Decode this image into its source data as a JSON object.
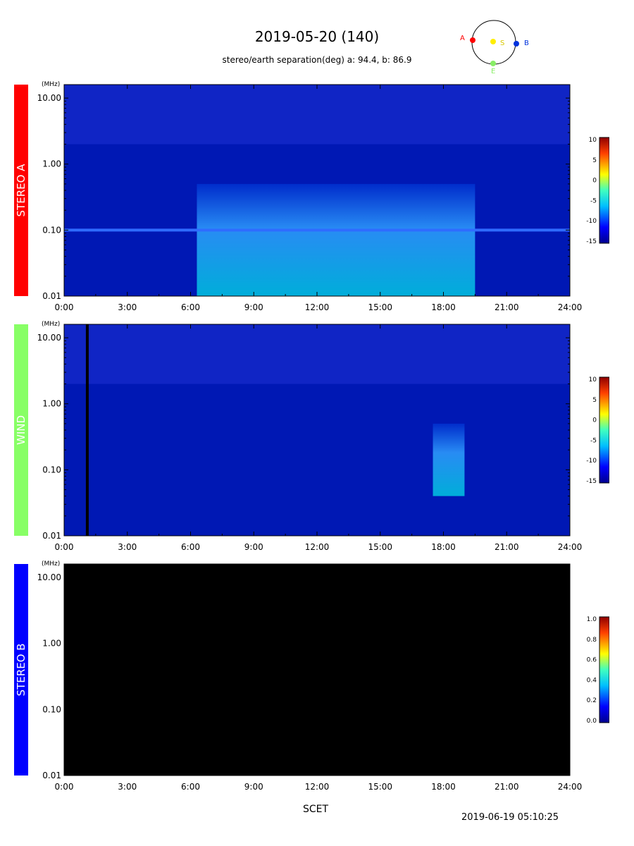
{
  "header": {
    "title": "2019-05-20 (140)",
    "separation": "stereo/earth separation(deg) a:  94.4, b:  86.9",
    "orbit_labels": {
      "a": "A",
      "s": "S",
      "b": "B",
      "e": "E"
    }
  },
  "footer": {
    "xlabel": "SCET",
    "timestamp": "2019-06-19 05:10:25"
  },
  "chart_data": [
    {
      "type": "heatmap",
      "panel": "STEREO A",
      "panel_color": "#ff0000",
      "y_unit": "(MHz)",
      "y_scale": "log",
      "ylim": [
        0.01,
        16
      ],
      "y_ticks": [
        "10.00",
        "1.00",
        "0.10",
        "0.01"
      ],
      "x_ticks": [
        "0:00",
        "3:00",
        "6:00",
        "9:00",
        "12:00",
        "15:00",
        "18:00",
        "21:00",
        "24:00"
      ],
      "xlim_hours": [
        0,
        24
      ],
      "colorbar": {
        "ticks": [
          "10",
          "5",
          "0",
          "-5",
          "-10",
          "-15"
        ],
        "range": [
          -15,
          10
        ]
      },
      "features": [
        {
          "kind": "enhanced emission band",
          "start_h": 6.3,
          "end_h": 19.5,
          "f_low_mhz": 0.01,
          "f_high_mhz": 0.5
        },
        {
          "kind": "line",
          "freq_mhz": 0.1,
          "start_h": 0,
          "end_h": 24
        }
      ]
    },
    {
      "type": "heatmap",
      "panel": "WIND",
      "panel_color": "#88ff66",
      "y_unit": "(MHz)",
      "y_scale": "log",
      "ylim": [
        0.01,
        16
      ],
      "y_ticks": [
        "10.00",
        "1.00",
        "0.10",
        "0.01"
      ],
      "x_ticks": [
        "0:00",
        "3:00",
        "6:00",
        "9:00",
        "12:00",
        "15:00",
        "18:00",
        "21:00",
        "24:00"
      ],
      "xlim_hours": [
        0,
        24
      ],
      "colorbar": {
        "ticks": [
          "10",
          "5",
          "0",
          "-5",
          "-10",
          "-15"
        ],
        "range": [
          -15,
          10
        ]
      },
      "features": [
        {
          "kind": "type III burst",
          "start_h": 17.5,
          "end_h": 19.0,
          "f_low_mhz": 0.04,
          "f_high_mhz": 0.5
        },
        {
          "kind": "data gap",
          "time_h": 1.1
        }
      ]
    },
    {
      "type": "heatmap",
      "panel": "STEREO B",
      "panel_color": "#0000ff",
      "y_unit": "(MHz)",
      "y_scale": "log",
      "ylim": [
        0.01,
        16
      ],
      "y_ticks": [
        "10.00",
        "1.00",
        "0.10",
        "0.01"
      ],
      "x_ticks": [
        "0:00",
        "3:00",
        "6:00",
        "9:00",
        "12:00",
        "15:00",
        "18:00",
        "21:00",
        "24:00"
      ],
      "xlim_hours": [
        0,
        24
      ],
      "colorbar": {
        "ticks": [
          "1.0",
          "0.8",
          "0.6",
          "0.4",
          "0.2",
          "0.0"
        ],
        "range": [
          0,
          1
        ]
      },
      "features": [
        {
          "kind": "no data"
        }
      ]
    }
  ]
}
